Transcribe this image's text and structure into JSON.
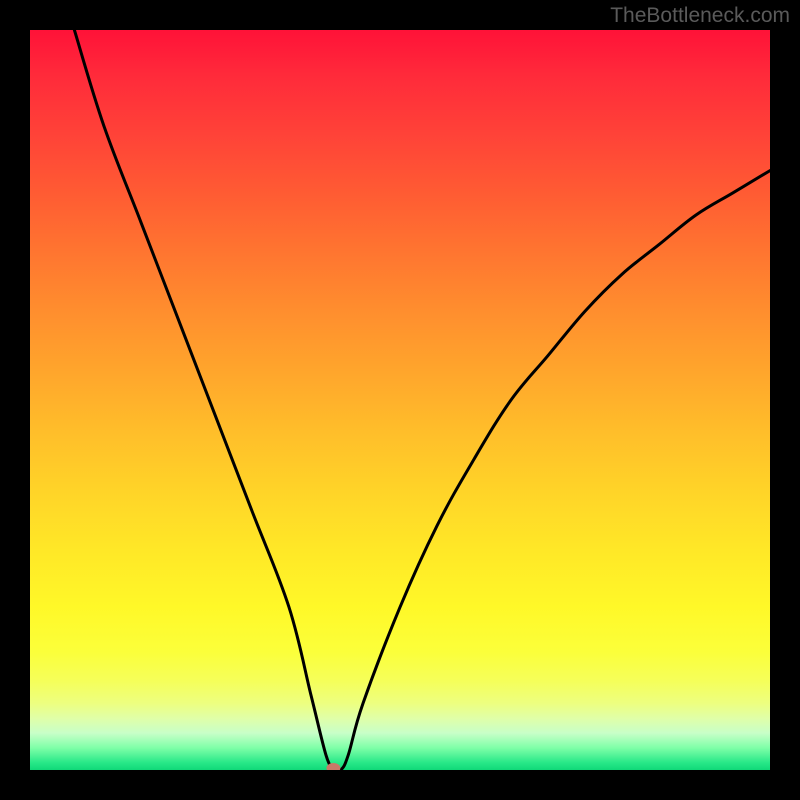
{
  "watermark": "TheBottleneck.com",
  "chart_data": {
    "type": "line",
    "title": "",
    "xlabel": "",
    "ylabel": "",
    "xlim": [
      0,
      100
    ],
    "ylim": [
      0,
      100
    ],
    "grid": false,
    "legend": false,
    "background": "rainbow-gradient-vertical",
    "gradient_colors_top_to_bottom": [
      "#ff1238",
      "#ffa52c",
      "#ffe727",
      "#f5ff5a",
      "#28e888"
    ],
    "series": [
      {
        "name": "bottleneck-curve",
        "color": "#000000",
        "x": [
          6,
          10,
          15,
          20,
          25,
          30,
          35,
          38,
          40,
          41,
          42,
          43,
          45,
          50,
          55,
          60,
          65,
          70,
          75,
          80,
          85,
          90,
          95,
          100
        ],
        "y": [
          100,
          87,
          74,
          61,
          48,
          35,
          22,
          10,
          2,
          0,
          0,
          2,
          9,
          22,
          33,
          42,
          50,
          56,
          62,
          67,
          71,
          75,
          78,
          81
        ]
      }
    ],
    "marker": {
      "x": 41,
      "y": 0,
      "color": "#c87868",
      "shape": "ellipse"
    },
    "notes": "V-shaped curve representing bottleneck percentage; minimum near x≈41 at y≈0. Background gradient encodes severity (red high, green low)."
  }
}
